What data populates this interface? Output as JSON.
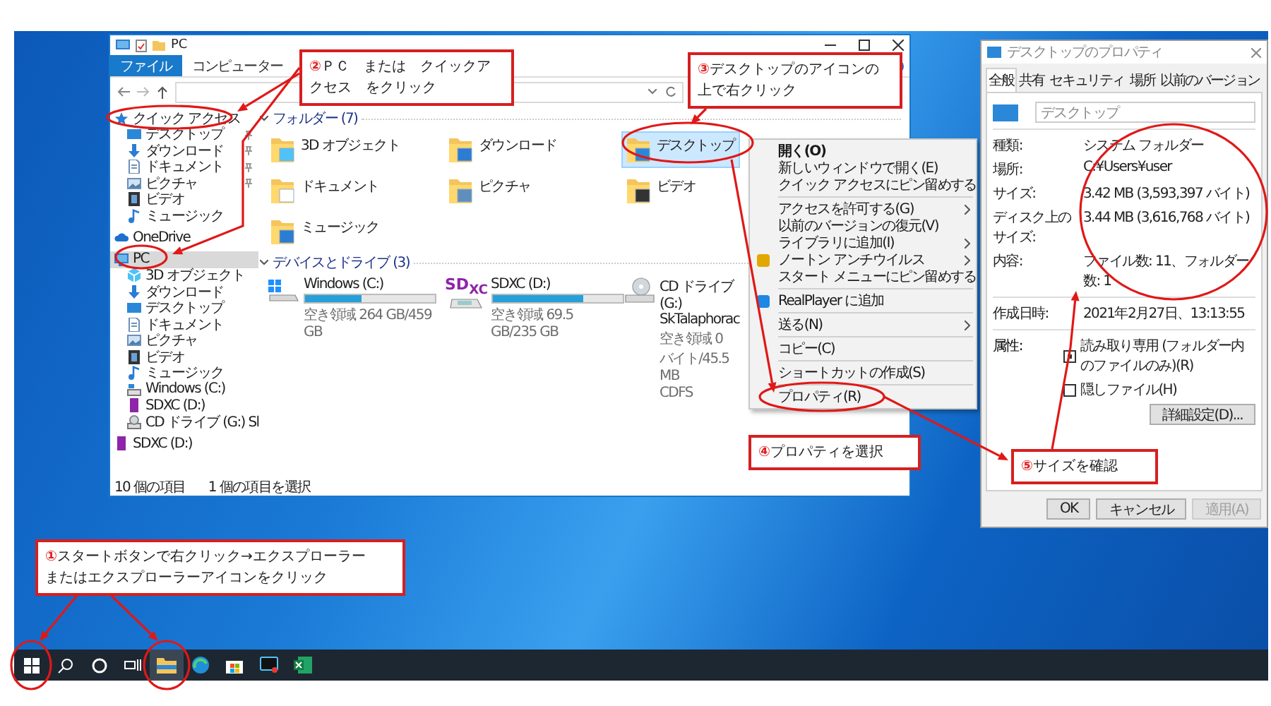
{
  "explorer": {
    "title": "PC",
    "ribbon_tabs": [
      {
        "label": "ファイル",
        "selected": true
      },
      {
        "label": "コンピューター",
        "selected": false
      }
    ],
    "nav": [
      {
        "label": "クイック アクセス",
        "kind": "star",
        "selected": false,
        "children": [
          {
            "label": "デスクトップ",
            "kind": "desktop",
            "selected": false,
            "pinned": true
          },
          {
            "label": "ダウンロード",
            "kind": "download",
            "selected": false,
            "pinned": true
          },
          {
            "label": "ドキュメント",
            "kind": "document",
            "selected": false,
            "pinned": true
          },
          {
            "label": "ピクチャ",
            "kind": "picture",
            "selected": false,
            "pinned": true
          },
          {
            "label": "ビデオ",
            "kind": "video",
            "selected": false
          },
          {
            "label": "ミュージック",
            "kind": "music",
            "selected": false
          }
        ]
      },
      {
        "label": "OneDrive",
        "kind": "cloud",
        "selected": false
      },
      {
        "label": "PC",
        "kind": "pc",
        "selected": true,
        "children": [
          {
            "label": "3D オブジェクト",
            "kind": "objects",
            "selected": false
          },
          {
            "label": "ダウンロード",
            "kind": "download",
            "selected": false
          },
          {
            "label": "デスクトップ",
            "kind": "desktop",
            "selected": false
          },
          {
            "label": "ドキュメント",
            "kind": "document",
            "selected": false
          },
          {
            "label": "ピクチャ",
            "kind": "picture",
            "selected": false
          },
          {
            "label": "ビデオ",
            "kind": "video",
            "selected": false
          },
          {
            "label": "ミュージック",
            "kind": "music",
            "selected": false
          },
          {
            "label": "Windows (C:)",
            "kind": "drive",
            "selected": false
          },
          {
            "label": "SDXC (D:)",
            "kind": "sd",
            "selected": false
          },
          {
            "label": "CD ドライブ (G:) Sl",
            "kind": "cd",
            "selected": false
          }
        ]
      },
      {
        "label": "SDXC (D:)",
        "kind": "sd",
        "selected": false
      }
    ],
    "folders": {
      "title": "フォルダー (7)",
      "items": [
        {
          "label": "3D オブジェクト",
          "kind": "objects",
          "selected": false
        },
        {
          "label": "ダウンロード",
          "kind": "download",
          "selected": false
        },
        {
          "label": "デスクトップ",
          "kind": "desktop",
          "selected": true
        },
        {
          "label": "ドキュメント",
          "kind": "document",
          "selected": false
        },
        {
          "label": "ピクチャ",
          "kind": "picture",
          "selected": false
        },
        {
          "label": "ビデオ",
          "kind": "video",
          "selected": false
        },
        {
          "label": "ミュージック",
          "kind": "music",
          "selected": false
        }
      ]
    },
    "drives": {
      "title": "デバイスとドライブ (3)",
      "items": [
        {
          "label": "Windows (C:)",
          "kind": "windows",
          "level": 0.43,
          "free": "空き領域 264 GB/459 GB"
        },
        {
          "label": "SDXC (D:)",
          "kind": "sd",
          "logo": "SD$_{XC}$",
          "level": 0.7,
          "free": "空き領域 69.5 GB/235 GB"
        },
        {
          "label": "CD ドライブ (G:) SkTalaphorac",
          "kind": "cd",
          "free": "空き領域 0 バイト/45.5 MB",
          "fs": "CDFS"
        }
      ]
    },
    "status": [
      "10 個の項目",
      "1 個の項目を選択"
    ]
  },
  "context_menu": [
    {
      "kind": "item",
      "label": "開く(O)",
      "bold": true
    },
    {
      "kind": "item",
      "label": "新しいウィンドウで開く(E)"
    },
    {
      "kind": "item",
      "label": "クイック アクセスにピン留めする"
    },
    {
      "kind": "separator"
    },
    {
      "kind": "item",
      "label": "アクセスを許可する(G)",
      "submenu": true
    },
    {
      "kind": "item",
      "label": "以前のバージョンの復元(V)"
    },
    {
      "kind": "item",
      "label": "ライブラリに追加(I)",
      "submenu": true
    },
    {
      "kind": "item",
      "label": "ノートン アンチウイルス",
      "submenu": true,
      "color": "#e0a800"
    },
    {
      "kind": "item",
      "label": "スタート メニューにピン留めする"
    },
    {
      "kind": "separator"
    },
    {
      "kind": "item",
      "label": "RealPlayer に追加",
      "color": "#1e88e5"
    },
    {
      "kind": "separator"
    },
    {
      "kind": "item",
      "label": "送る(N)",
      "submenu": true
    },
    {
      "kind": "separator"
    },
    {
      "kind": "item",
      "label": "コピー(C)"
    },
    {
      "kind": "separator"
    },
    {
      "kind": "item",
      "label": "ショートカットの作成(S)"
    },
    {
      "kind": "separator"
    },
    {
      "kind": "item",
      "label": "プロパティ(R)"
    }
  ],
  "properties": {
    "title": "デスクトップのプロパティ",
    "tabs": [
      {
        "label": "全般",
        "selected": true
      },
      {
        "label": "共有",
        "selected": false
      },
      {
        "label": "セキュリティ",
        "selected": false
      },
      {
        "label": "場所",
        "selected": false
      },
      {
        "label": "以前のバージョン",
        "selected": false
      }
    ],
    "name": "デスクトップ",
    "groups": [
      [
        {
          "label": "種類:",
          "value": "システム フォルダー"
        },
        {
          "label": "場所:",
          "value": "C:¥Users¥user"
        },
        {
          "label": "サイズ:",
          "value": "3.42 MB (3,593,397 バイト)"
        },
        {
          "label": "ディスク上のサイズ:",
          "value": "3.44 MB (3,616,768 バイト)"
        },
        {
          "label": "内容:",
          "value": "ファイル数: 11、フォルダー数: 1"
        }
      ],
      [
        {
          "label": "作成日時:",
          "value": "2021年2月27日、13:13:55"
        }
      ]
    ],
    "attributes_label": "属性:",
    "attributes": [
      {
        "label": "読み取り専用 (フォルダー内のファイルのみ)(R)",
        "checked": true
      },
      {
        "label": "隠しファイル(H)",
        "checked": false
      }
    ],
    "advanced_button": "詳細設定(D)...",
    "buttons": [
      {
        "label": "OK",
        "disabled": false
      },
      {
        "label": "キャンセル",
        "disabled": false
      },
      {
        "label": "適用(A)",
        "disabled": true
      }
    ]
  },
  "callouts": [
    {
      "number": "①",
      "lines": [
        "スタートボタンで右クリック→エクスプローラー",
        "またはエクスプローラーアイコンをクリック"
      ]
    },
    {
      "number": "②",
      "lines": [
        "ＰＣ　または　クイックア",
        "クセス　をクリック"
      ]
    },
    {
      "number": "③",
      "lines": [
        "デスクトップのアイコンの",
        "上で右クリック"
      ]
    },
    {
      "number": "④",
      "lines": [
        "プロパティを選択"
      ]
    },
    {
      "number": "⑤",
      "lines": [
        "サイズを確認"
      ]
    }
  ]
}
